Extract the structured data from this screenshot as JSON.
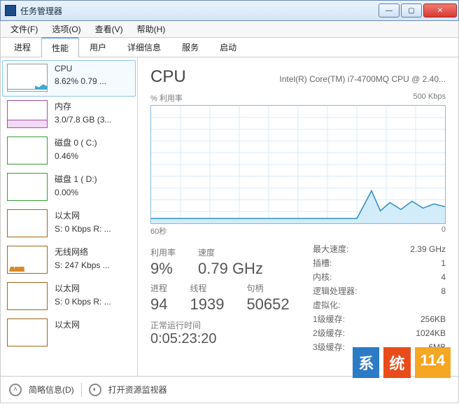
{
  "window": {
    "title": "任务管理器"
  },
  "menu": {
    "file": "文件(F)",
    "options": "选项(O)",
    "view": "查看(V)",
    "help": "帮助(H)"
  },
  "tabs": {
    "processes": "进程",
    "performance": "性能",
    "users": "用户",
    "details": "详细信息",
    "services": "服务",
    "startup": "启动"
  },
  "sidebar": {
    "cpu": {
      "name": "CPU",
      "val": "8.62%  0.79 ..."
    },
    "mem": {
      "name": "内存",
      "val": "3.0/7.8 GB (3..."
    },
    "diskC": {
      "name": "磁盘 0  ( C:)",
      "val": "0.46%"
    },
    "diskD": {
      "name": "磁盘 1  ( D:)",
      "val": "0.00%"
    },
    "eth1": {
      "name": "以太网",
      "val": "S: 0 Kbps R: ..."
    },
    "wifi": {
      "name": "无线网络",
      "val": "S: 247 Kbps ..."
    },
    "eth2": {
      "name": "以太网",
      "val": "S: 0 Kbps R: ..."
    },
    "eth3": {
      "name": "以太网",
      "val": ""
    }
  },
  "detail": {
    "title": "CPU",
    "subtitle": "Intel(R) Core(TM) i7-4700MQ CPU @ 2.40...",
    "chart_top_left": "% 利用率",
    "chart_top_right": "500 Kbps",
    "chart_bottom_left": "60秒",
    "chart_bottom_right": "0",
    "util_label": "利用率",
    "util": "9%",
    "speed_label": "速度",
    "speed": "0.79 GHz",
    "proc_label": "进程",
    "proc": "94",
    "thread_label": "线程",
    "thread": "1939",
    "handle_label": "句柄",
    "handle": "50652",
    "uptime_label": "正常运行时间",
    "uptime": "0:05:23:20",
    "max_speed_k": "最大速度:",
    "max_speed_v": "2.39 GHz",
    "sockets_k": "插槽:",
    "sockets_v": "1",
    "cores_k": "内核:",
    "cores_v": "4",
    "lproc_k": "逻辑处理器:",
    "lproc_v": "8",
    "virt_k": "虚拟化:",
    "virt_v": "",
    "l1_k": "1级缓存:",
    "l1_v": "256KB",
    "l2_k": "2级缓存:",
    "l2_v": "1024KB",
    "l3_k": "3级缓存:",
    "l3_v": "6MB"
  },
  "footer": {
    "fewer": "简略信息(D)",
    "resmon": "打开资源监视器"
  },
  "watermark": {
    "a": "系",
    "b": "统",
    "c": "114"
  },
  "chart_data": {
    "type": "line",
    "title": "CPU % 利用率",
    "xlabel": "60秒 → 0",
    "ylabel": "% 利用率",
    "ylim": [
      0,
      100
    ],
    "x": [
      0,
      5,
      10,
      15,
      20,
      25,
      30,
      35,
      40,
      45,
      50,
      55,
      60
    ],
    "values": [
      4,
      4,
      4,
      4,
      4,
      4,
      4,
      4,
      4,
      28,
      14,
      18,
      15
    ]
  }
}
